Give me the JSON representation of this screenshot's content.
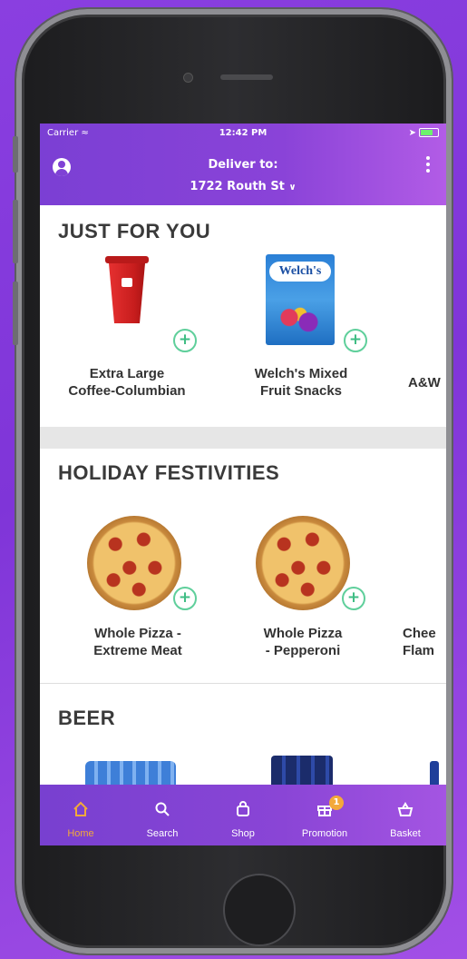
{
  "status_bar": {
    "carrier": "Carrier",
    "time": "12:42 PM"
  },
  "header": {
    "deliver_label": "Deliver to:",
    "address": "1722 Routh St"
  },
  "sections": [
    {
      "title": "JUST FOR YOU",
      "products": [
        {
          "name_line1": "Extra Large",
          "name_line2": "Coffee-Columbian",
          "icon": "coffee-cup"
        },
        {
          "name_line1": "Welch's Mixed",
          "name_line2": "Fruit Snacks",
          "icon": "fruit-snacks",
          "brand_text": "Welch's"
        },
        {
          "name_partial": "A&W",
          "icon": "soda"
        }
      ]
    },
    {
      "title": "HOLIDAY FESTIVITIES",
      "products": [
        {
          "name_line1": "Whole Pizza -",
          "name_line2": "Extreme Meat",
          "icon": "pizza"
        },
        {
          "name_line1": "Whole Pizza",
          "name_line2": "- Pepperoni",
          "icon": "pizza"
        },
        {
          "name_line1_partial": "Chee",
          "name_line2_partial": "Flam",
          "icon": "pizza"
        }
      ]
    },
    {
      "title": "BEER",
      "products": []
    }
  ],
  "add_button_symbol": "+",
  "bottom_nav": [
    {
      "label": "Home",
      "icon": "home-icon",
      "active": true
    },
    {
      "label": "Search",
      "icon": "search-icon",
      "active": false
    },
    {
      "label": "Shop",
      "icon": "shopping-bag-icon",
      "active": false
    },
    {
      "label": "Promotion",
      "icon": "gift-icon",
      "active": false,
      "badge": "1"
    },
    {
      "label": "Basket",
      "icon": "basket-icon",
      "active": false
    }
  ],
  "colors": {
    "accent_purple": "#7f41d5",
    "active_nav": "#f3a93a",
    "add_green": "#5fcf9b"
  }
}
